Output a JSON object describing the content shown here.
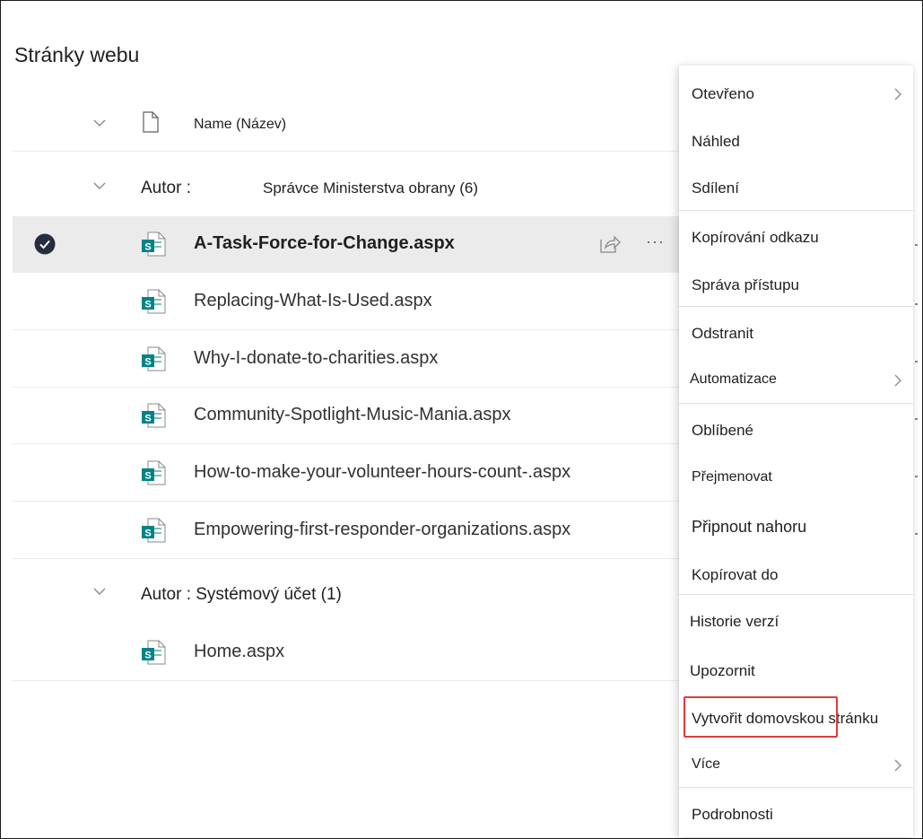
{
  "page": {
    "title": "Stránky webu"
  },
  "header": {
    "name_column": "Name (Název)"
  },
  "groups": [
    {
      "label": "Autor :",
      "value": "Správce Ministerstva obrany (6)"
    },
    {
      "label": "Autor : Systémový účet (1)",
      "value": ""
    }
  ],
  "files": [
    {
      "name": "A-Task-Force-for-Change.aspx",
      "selected": true
    },
    {
      "name": "Replacing-What-Is-Used.aspx",
      "selected": false
    },
    {
      "name": "Why-I-donate-to-charities.aspx",
      "selected": false
    },
    {
      "name": "Community-Spotlight-Music-Mania.aspx",
      "selected": false
    },
    {
      "name": "How-to-make-your-volunteer-hours-count-.aspx",
      "selected": false
    },
    {
      "name": "Empowering-first-responder-organizations.aspx",
      "selected": false
    },
    {
      "name": "Home.aspx",
      "selected": false
    }
  ],
  "row_actions": {
    "more": "···"
  },
  "context_menu": {
    "items": [
      {
        "label": "Otevřeno",
        "submenu": true
      },
      {
        "label": "Náhled",
        "submenu": false
      },
      {
        "label": "Sdílení",
        "submenu": false
      },
      {
        "label": "Kopírování odkazu",
        "submenu": false
      },
      {
        "label": "Správa přístupu",
        "submenu": false
      },
      {
        "label": "Odstranit",
        "submenu": false
      },
      {
        "label": "Automatizace",
        "submenu": true
      },
      {
        "label": "Oblíbené",
        "submenu": false
      },
      {
        "label": "Přejmenovat",
        "submenu": false
      },
      {
        "label": "Připnout nahoru",
        "submenu": false
      },
      {
        "label": "Kopírovat do",
        "submenu": false
      },
      {
        "label": "Historie verzí",
        "submenu": false
      },
      {
        "label": "Upozornit",
        "submenu": false
      },
      {
        "label": "Vytvořit domovskou stránku",
        "submenu": false,
        "highlighted": true
      },
      {
        "label": "Více",
        "submenu": true
      },
      {
        "label": "Podrobnosti",
        "submenu": false
      }
    ]
  },
  "colors": {
    "sharepoint_teal": "#038387",
    "highlight_red": "#e03b3b",
    "selected_row": "#ebebeb"
  }
}
